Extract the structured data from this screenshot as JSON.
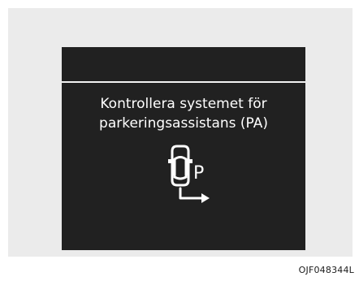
{
  "display": {
    "message_line1": "Kontrollera systemet för",
    "message_line2": "parkeringsassistans (PA)",
    "icon": "parking-assist-car-icon",
    "icon_letter": "P"
  },
  "figure_code": "OJF048344L",
  "colors": {
    "screen": "#212121",
    "frame": "#ebebeb",
    "text": "#ffffff"
  }
}
